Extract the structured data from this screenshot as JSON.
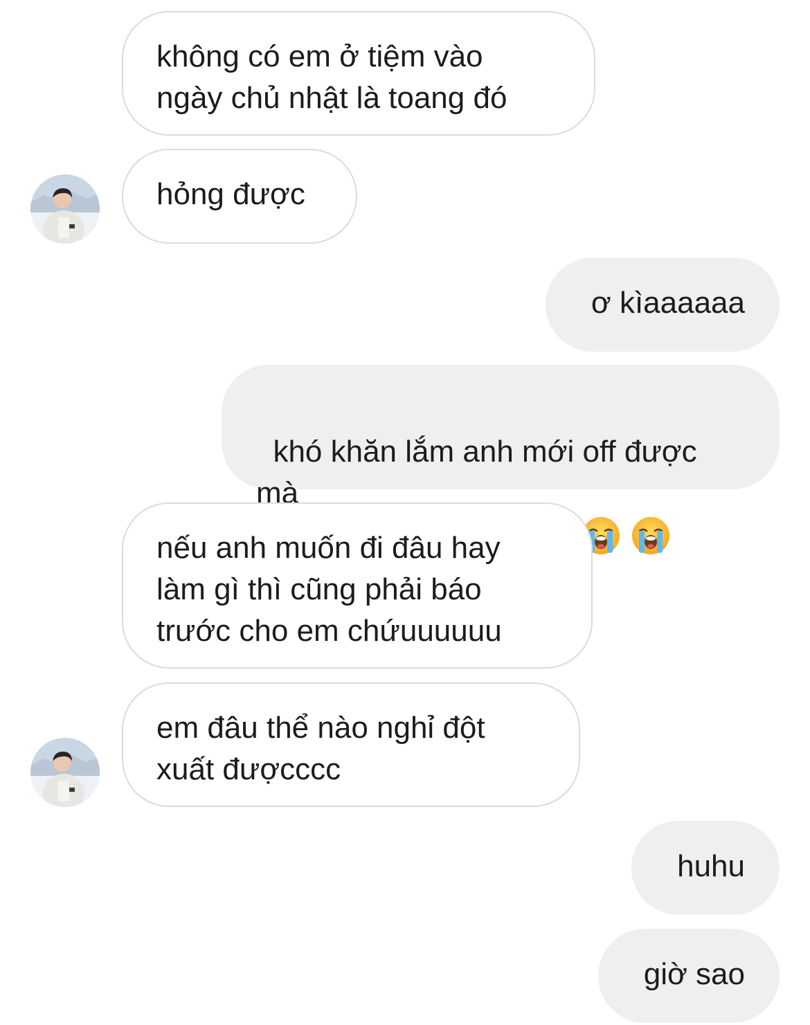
{
  "messages": [
    {
      "id": "m1",
      "direction": "incoming",
      "text": "không có em ở tiệm vào\nngày chủ nhật là toang đó"
    },
    {
      "id": "m2",
      "direction": "incoming",
      "text": "hỏng được",
      "avatar": "user-avatar"
    },
    {
      "id": "m3",
      "direction": "outgoing",
      "text": "ơ kìaaaaaa"
    },
    {
      "id": "m4",
      "direction": "outgoing",
      "text": "khó khăn lắm anh mới off được\nmà",
      "emoji": "loudly-crying-face-emoji",
      "emoji_count": 8
    },
    {
      "id": "m5",
      "direction": "incoming",
      "text": "nếu anh muốn đi đâu hay\nlàm gì thì cũng phải báo\ntrước cho em chứuuuuuu"
    },
    {
      "id": "m6",
      "direction": "incoming",
      "text": "em đâu thể nào nghỉ đột\nxuất đượcccc",
      "avatar": "user-avatar"
    },
    {
      "id": "m7",
      "direction": "outgoing",
      "text": "huhu"
    },
    {
      "id": "m8",
      "direction": "outgoing",
      "text": "giờ sao"
    }
  ],
  "colors": {
    "incoming_bg": "#ffffff",
    "incoming_border": "#dbdbdb",
    "outgoing_bg": "#efefef",
    "text": "#1c1c1c"
  }
}
